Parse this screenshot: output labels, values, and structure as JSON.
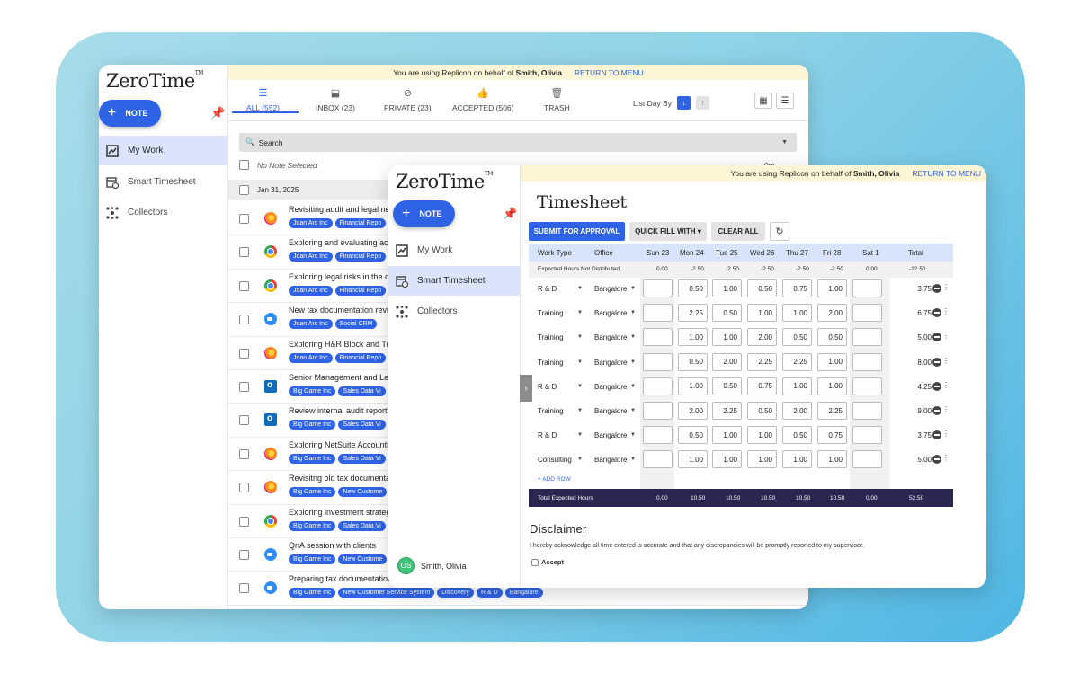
{
  "brand": "ZeroTime",
  "brand_tm": "TM",
  "note_label": "NOTE",
  "banner": {
    "prefix": "You are using Replicon on behalf of",
    "user": "Smith, Olivia",
    "return": "RETURN TO MENU"
  },
  "nav": [
    {
      "label": "My Work",
      "icon": "chart-icon"
    },
    {
      "label": "Smart Timesheet",
      "icon": "calendar-clock-icon"
    },
    {
      "label": "Collectors",
      "icon": "hub-icon"
    }
  ],
  "tabs": [
    {
      "label": "ALL (552)",
      "icon": "list-icon",
      "glyph": "☰"
    },
    {
      "label": "INBOX (23)",
      "icon": "inbox-icon",
      "glyph": "⬓"
    },
    {
      "label": "PRIVATE (23)",
      "icon": "private-icon",
      "glyph": "⊘"
    },
    {
      "label": "ACCEPTED (506)",
      "icon": "thumbs-up-icon",
      "glyph": "👍"
    },
    {
      "label": "TRASH",
      "icon": "trash-icon",
      "glyph": "🗑"
    }
  ],
  "list_day_by": "List Day By",
  "search_label": "Search",
  "no_note": "No Note Selected",
  "zero_min": "0m",
  "date_group": "Jan 31, 2025",
  "notes": [
    {
      "title": "Revisiting audit and legal ne",
      "app": "ff",
      "chips": [
        "Joan Arc Inc",
        "Financial Repo"
      ]
    },
    {
      "title": "Exploring and evaluating acc",
      "app": "ch",
      "chips": [
        "Joan Arc Inc",
        "Financial Repo"
      ]
    },
    {
      "title": "Exploring legal risks in the c",
      "app": "ch",
      "chips": [
        "Joan Arc Inc",
        "Financial Repo"
      ]
    },
    {
      "title": "New tax documentation revi",
      "app": "zo",
      "chips": [
        "Joan Arc Inc",
        "Social CRM"
      ]
    },
    {
      "title": "Exploring H&R Block and Tu",
      "app": "ff",
      "chips": [
        "Joan Arc Inc",
        "Financial Repo"
      ]
    },
    {
      "title": "Senior Management and Leg",
      "app": "ol",
      "chips": [
        "Big Game Inc",
        "Sales Data Vi"
      ]
    },
    {
      "title": "Review internal audit report",
      "app": "ol",
      "chips": [
        "Big Game Inc",
        "Sales Data Vi"
      ]
    },
    {
      "title": "Exploring NetSuite Accounti",
      "app": "ff",
      "chips": [
        "Big Game Inc",
        "Sales Data Vi"
      ]
    },
    {
      "title": "Revisitng old tax documenta",
      "app": "ff",
      "chips": [
        "Big Game Inc",
        "New Custome"
      ]
    },
    {
      "title": "Exploring investment strateg",
      "app": "ch",
      "chips": [
        "Big Game Inc",
        "Sales Data Vi"
      ]
    },
    {
      "title": "QnA session with clients",
      "app": "zo",
      "chips": [
        "Big Game Inc",
        "New Custome"
      ]
    },
    {
      "title": "Preparing tax documentation",
      "app": "zo",
      "chips": [
        "Big Game Inc",
        "New Customer Service System",
        "Discovery",
        "R & D",
        "Bangalore"
      ]
    }
  ],
  "timesheet": {
    "title": "Timesheet",
    "submit": "SUBMIT FOR APPROVAL",
    "quick_fill": "QUICK FILL WITH",
    "clear_all": "CLEAR ALL",
    "headers": [
      "Work Type",
      "Office",
      "Sun 23",
      "Mon 24",
      "Tue 25",
      "Wed 26",
      "Thu 27",
      "Fri 28",
      "Sat 1",
      "Total"
    ],
    "expected_label": "Expected Hours Not Distributed",
    "expected": [
      "0.00",
      "-2.50",
      "-2.50",
      "-2.50",
      "-2.50",
      "-2.50",
      "0.00",
      "-12.50"
    ],
    "rows": [
      {
        "type": "R & D",
        "office": "Bangalore",
        "hours": [
          "",
          "0.50",
          "1.00",
          "0.50",
          "0.75",
          "1.00",
          ""
        ],
        "total": "3.75"
      },
      {
        "type": "Training",
        "office": "Bangalore",
        "hours": [
          "",
          "2.25",
          "0.50",
          "1.00",
          "1.00",
          "2.00",
          ""
        ],
        "total": "6.75"
      },
      {
        "type": "Training",
        "office": "Bangalore",
        "hours": [
          "",
          "1.00",
          "1.00",
          "2.00",
          "0.50",
          "0.50",
          ""
        ],
        "total": "5.00"
      },
      {
        "type": "Training",
        "office": "Bangalore",
        "hours": [
          "",
          "0.50",
          "2.00",
          "2.25",
          "2.25",
          "1.00",
          ""
        ],
        "total": "8.00"
      },
      {
        "type": "R & D",
        "office": "Bangalore",
        "hours": [
          "",
          "1.00",
          "0.50",
          "0.75",
          "1.00",
          "1.00",
          ""
        ],
        "total": "4.25"
      },
      {
        "type": "Training",
        "office": "Bangalore",
        "hours": [
          "",
          "2.00",
          "2.25",
          "0.50",
          "2.00",
          "2.25",
          ""
        ],
        "total": "9.00"
      },
      {
        "type": "R & D",
        "office": "Bangalore",
        "hours": [
          "",
          "0.50",
          "1.00",
          "1.00",
          "0.50",
          "0.75",
          ""
        ],
        "total": "3.75"
      },
      {
        "type": "Consulting",
        "office": "Bangalore",
        "hours": [
          "",
          "1.00",
          "1.00",
          "1.00",
          "1.00",
          "1.00",
          ""
        ],
        "total": "5.00"
      }
    ],
    "add_row": "+ ADD ROW",
    "total_label": "Total Expected Hours",
    "totals": [
      "0.00",
      "10.50",
      "10.50",
      "10.50",
      "10.50",
      "10.50",
      "0.00",
      "52.50"
    ],
    "disclaimer_title": "Disclaimer",
    "disclaimer_text": "I hereby acknowledge all time entered is accurate and that any discrepancies will be promptly reported to my supervisor.",
    "accept": "Accept"
  },
  "user": {
    "initials": "OS",
    "name": "Smith, Olivia"
  },
  "colors": {
    "accent": "#2f63e6",
    "total_bar": "#2b2650",
    "banner": "#fdf6d6",
    "active_nav": "#dbe4fb"
  }
}
